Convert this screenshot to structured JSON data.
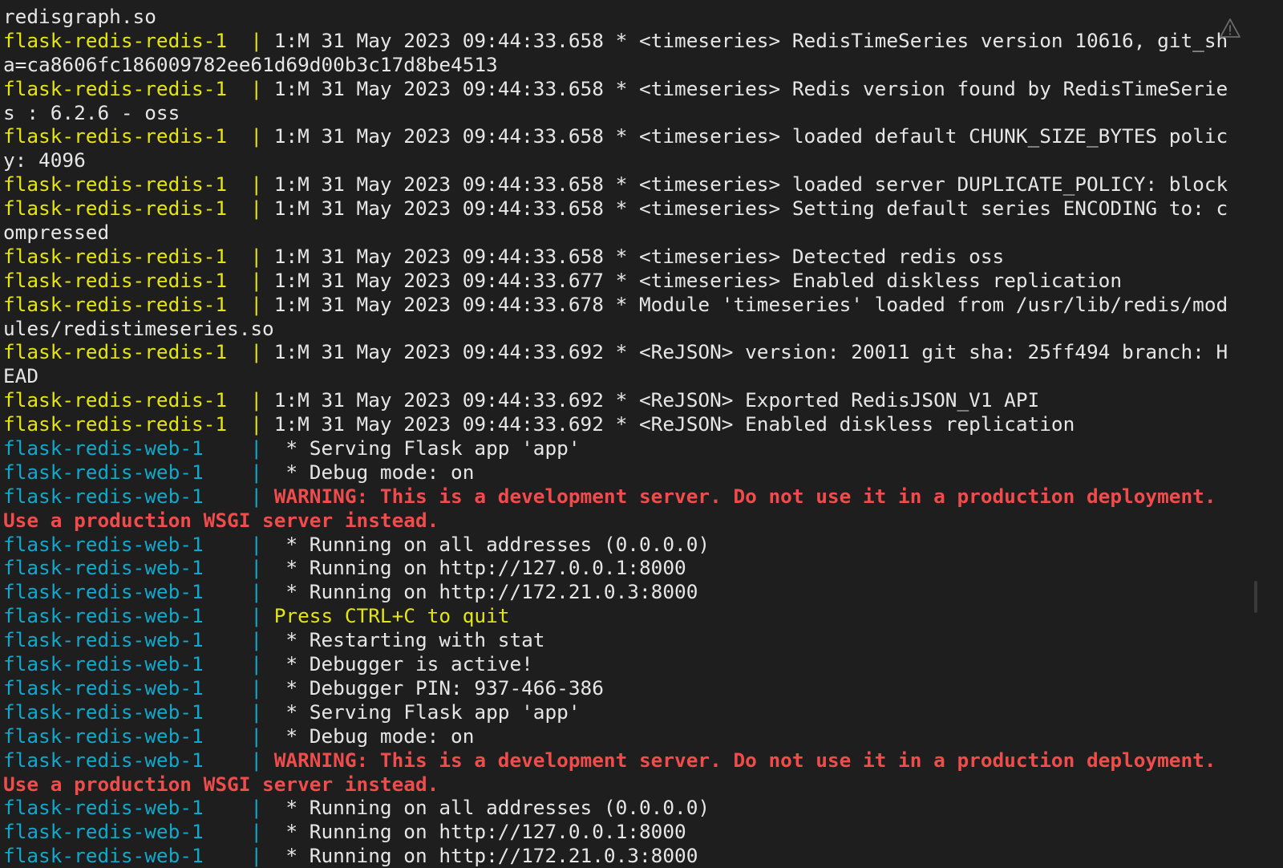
{
  "terminal": {
    "colors": {
      "background": "#1e1e1e",
      "yellow": "#e5e510",
      "cyan": "#11a8cd",
      "red": "#f14c4c",
      "plain": "#e6e6e6"
    },
    "lines": [
      [
        {
          "t": "redisgraph.so",
          "c": "plain"
        }
      ],
      [
        {
          "t": "flask-redis-redis-1  | ",
          "c": "yellow"
        },
        {
          "t": "1:M 31 May 2023 09:44:33.658 * <timeseries> RedisTimeSeries version 10616, git_sh",
          "c": "plain"
        }
      ],
      [
        {
          "t": "a=ca8606fc186009782ee61d69d00b3c17d8be4513",
          "c": "plain"
        }
      ],
      [
        {
          "t": "flask-redis-redis-1  | ",
          "c": "yellow"
        },
        {
          "t": "1:M 31 May 2023 09:44:33.658 * <timeseries> Redis version found by RedisTimeSerie",
          "c": "plain"
        }
      ],
      [
        {
          "t": "s : 6.2.6 - oss",
          "c": "plain"
        }
      ],
      [
        {
          "t": "flask-redis-redis-1  | ",
          "c": "yellow"
        },
        {
          "t": "1:M 31 May 2023 09:44:33.658 * <timeseries> loaded default CHUNK_SIZE_BYTES polic",
          "c": "plain"
        }
      ],
      [
        {
          "t": "y: 4096",
          "c": "plain"
        }
      ],
      [
        {
          "t": "flask-redis-redis-1  | ",
          "c": "yellow"
        },
        {
          "t": "1:M 31 May 2023 09:44:33.658 * <timeseries> loaded server DUPLICATE_POLICY: block",
          "c": "plain"
        }
      ],
      [
        {
          "t": "flask-redis-redis-1  | ",
          "c": "yellow"
        },
        {
          "t": "1:M 31 May 2023 09:44:33.658 * <timeseries> Setting default series ENCODING to: c",
          "c": "plain"
        }
      ],
      [
        {
          "t": "ompressed",
          "c": "plain"
        }
      ],
      [
        {
          "t": "flask-redis-redis-1  | ",
          "c": "yellow"
        },
        {
          "t": "1:M 31 May 2023 09:44:33.658 * <timeseries> Detected redis oss",
          "c": "plain"
        }
      ],
      [
        {
          "t": "flask-redis-redis-1  | ",
          "c": "yellow"
        },
        {
          "t": "1:M 31 May 2023 09:44:33.677 * <timeseries> Enabled diskless replication",
          "c": "plain"
        }
      ],
      [
        {
          "t": "flask-redis-redis-1  | ",
          "c": "yellow"
        },
        {
          "t": "1:M 31 May 2023 09:44:33.678 * Module 'timeseries' loaded from /usr/lib/redis/mod",
          "c": "plain"
        }
      ],
      [
        {
          "t": "ules/redistimeseries.so",
          "c": "plain"
        }
      ],
      [
        {
          "t": "flask-redis-redis-1  | ",
          "c": "yellow"
        },
        {
          "t": "1:M 31 May 2023 09:44:33.692 * <ReJSON> version: 20011 git sha: 25ff494 branch: H",
          "c": "plain"
        }
      ],
      [
        {
          "t": "EAD",
          "c": "plain"
        }
      ],
      [
        {
          "t": "flask-redis-redis-1  | ",
          "c": "yellow"
        },
        {
          "t": "1:M 31 May 2023 09:44:33.692 * <ReJSON> Exported RedisJSON_V1 API",
          "c": "plain"
        }
      ],
      [
        {
          "t": "flask-redis-redis-1  | ",
          "c": "yellow"
        },
        {
          "t": "1:M 31 May 2023 09:44:33.692 * <ReJSON> Enabled diskless replication",
          "c": "plain"
        }
      ],
      [
        {
          "t": "flask-redis-web-1    | ",
          "c": "cyan"
        },
        {
          "t": " * Serving Flask app 'app'",
          "c": "plain"
        }
      ],
      [
        {
          "t": "flask-redis-web-1    | ",
          "c": "cyan"
        },
        {
          "t": " * Debug mode: on",
          "c": "plain"
        }
      ],
      [
        {
          "t": "flask-redis-web-1    | ",
          "c": "cyan"
        },
        {
          "t": "WARNING: This is a development server. Do not use it in a production deployment.",
          "c": "red"
        }
      ],
      [
        {
          "t": "Use a production WSGI server instead.",
          "c": "red"
        }
      ],
      [
        {
          "t": "flask-redis-web-1    | ",
          "c": "cyan"
        },
        {
          "t": " * Running on all addresses (0.0.0.0)",
          "c": "plain"
        }
      ],
      [
        {
          "t": "flask-redis-web-1    | ",
          "c": "cyan"
        },
        {
          "t": " * Running on http://127.0.0.1:8000",
          "c": "plain"
        }
      ],
      [
        {
          "t": "flask-redis-web-1    | ",
          "c": "cyan"
        },
        {
          "t": " * Running on http://172.21.0.3:8000",
          "c": "plain"
        }
      ],
      [
        {
          "t": "flask-redis-web-1    | ",
          "c": "cyan"
        },
        {
          "t": "Press CTRL+C to quit",
          "c": "yellow"
        }
      ],
      [
        {
          "t": "flask-redis-web-1    | ",
          "c": "cyan"
        },
        {
          "t": " * Restarting with stat",
          "c": "plain"
        }
      ],
      [
        {
          "t": "flask-redis-web-1    | ",
          "c": "cyan"
        },
        {
          "t": " * Debugger is active!",
          "c": "plain"
        }
      ],
      [
        {
          "t": "flask-redis-web-1    | ",
          "c": "cyan"
        },
        {
          "t": " * Debugger PIN: 937-466-386",
          "c": "plain"
        }
      ],
      [
        {
          "t": "flask-redis-web-1    | ",
          "c": "cyan"
        },
        {
          "t": " * Serving Flask app 'app'",
          "c": "plain"
        }
      ],
      [
        {
          "t": "flask-redis-web-1    | ",
          "c": "cyan"
        },
        {
          "t": " * Debug mode: on",
          "c": "plain"
        }
      ],
      [
        {
          "t": "flask-redis-web-1    | ",
          "c": "cyan"
        },
        {
          "t": "WARNING: This is a development server. Do not use it in a production deployment.",
          "c": "red"
        }
      ],
      [
        {
          "t": "Use a production WSGI server instead.",
          "c": "red"
        }
      ],
      [
        {
          "t": "flask-redis-web-1    | ",
          "c": "cyan"
        },
        {
          "t": " * Running on all addresses (0.0.0.0)",
          "c": "plain"
        }
      ],
      [
        {
          "t": "flask-redis-web-1    | ",
          "c": "cyan"
        },
        {
          "t": " * Running on http://127.0.0.1:8000",
          "c": "plain"
        }
      ],
      [
        {
          "t": "flask-redis-web-1    | ",
          "c": "cyan"
        },
        {
          "t": " * Running on http://172.21.0.3:8000",
          "c": "plain"
        }
      ]
    ],
    "icons": {
      "warning": "warning-icon"
    }
  }
}
